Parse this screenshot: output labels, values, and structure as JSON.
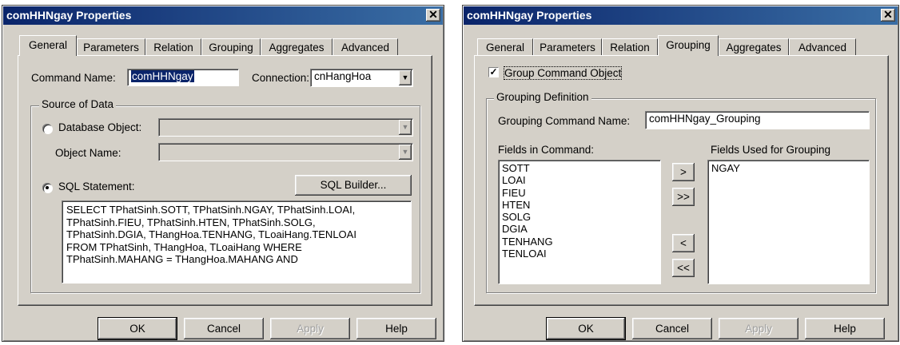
{
  "left": {
    "title": "comHHNgay Properties",
    "close": "✕",
    "tabs": [
      "General",
      "Parameters",
      "Relation",
      "Grouping",
      "Aggregates",
      "Advanced"
    ],
    "command_name_label": "Command Name:",
    "command_name_value": "comHHNgay",
    "connection_label": "Connection:",
    "connection_value": "cnHangHoa",
    "source_group": "Source of Data",
    "database_object_label": "Database Object:",
    "object_name_label": "Object Name:",
    "sql_statement_label": "SQL Statement:",
    "sql_builder": "SQL Builder...",
    "sql_text": "SELECT TPhatSinh.SOTT, TPhatSinh.NGAY, TPhatSinh.LOAI,\nTPhatSinh.FIEU, TPhatSinh.HTEN, TPhatSinh.SOLG,\nTPhatSinh.DGIA, THangHoa.TENHANG, TLoaiHang.TENLOAI\nFROM TPhatSinh, THangHoa, TLoaiHang WHERE\nTPhatSinh.MAHANG = THangHoa.MAHANG AND",
    "buttons": {
      "ok": "OK",
      "cancel": "Cancel",
      "apply": "Apply",
      "help": "Help"
    }
  },
  "right": {
    "title": "comHHNgay Properties",
    "close": "✕",
    "tabs": [
      "General",
      "Parameters",
      "Relation",
      "Grouping",
      "Aggregates",
      "Advanced"
    ],
    "group_command_object": "Group Command Object",
    "grouping_definition": "Grouping Definition",
    "grouping_command_name_label": "Grouping Command Name:",
    "grouping_command_name_value": "comHHNgay_Grouping",
    "fields_in_command_label": "Fields in Command:",
    "fields_used_label": "Fields Used for Grouping",
    "fields_in_command": [
      "SOTT",
      "LOAI",
      "FIEU",
      "HTEN",
      "SOLG",
      "DGIA",
      "TENHANG",
      "TENLOAI"
    ],
    "fields_used": [
      "NGAY"
    ],
    "move": {
      "one_right": ">",
      "all_right": ">>",
      "one_left": "<",
      "all_left": "<<"
    },
    "buttons": {
      "ok": "OK",
      "cancel": "Cancel",
      "apply": "Apply",
      "help": "Help"
    }
  }
}
